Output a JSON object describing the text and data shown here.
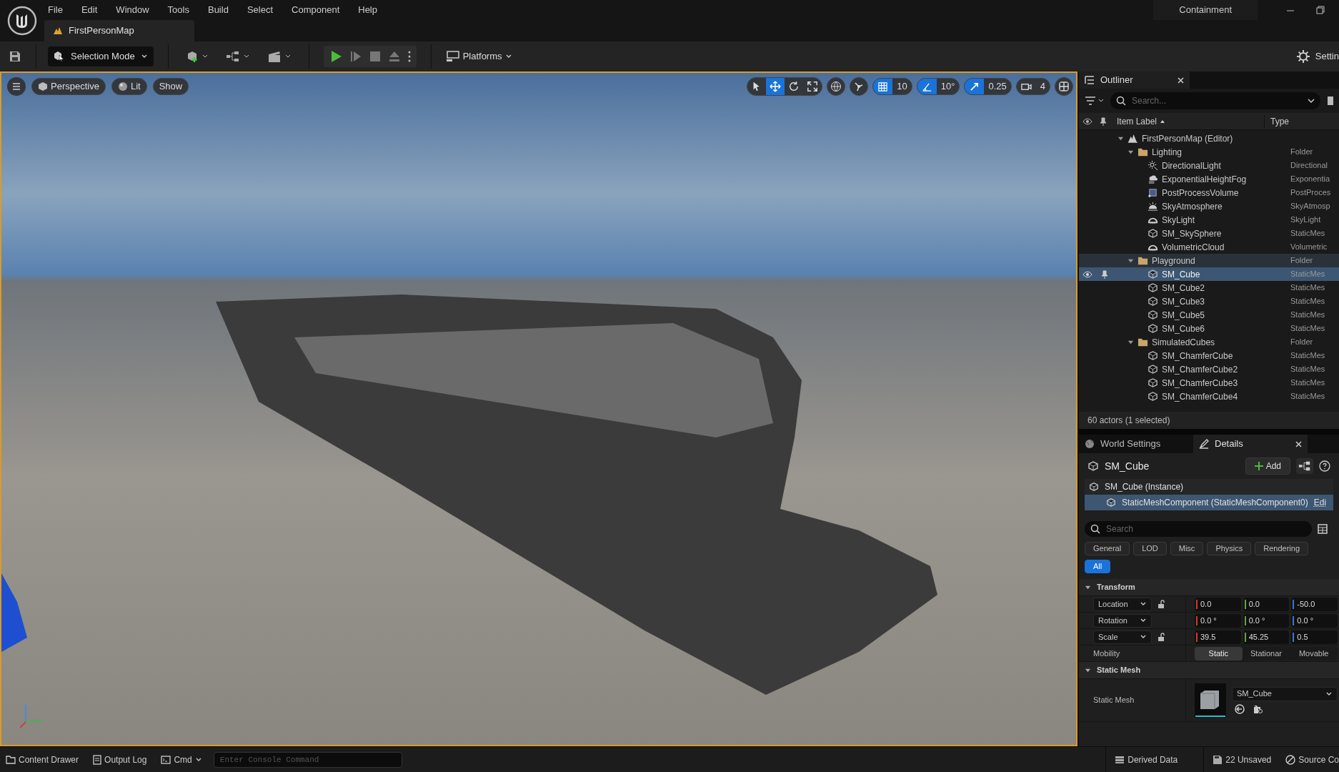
{
  "menu": [
    "File",
    "Edit",
    "Window",
    "Tools",
    "Build",
    "Select",
    "Component",
    "Help"
  ],
  "level_tab": {
    "label": "FirstPersonMap"
  },
  "layout_name": "Containment",
  "toolbar": {
    "mode": "Selection Mode",
    "platforms": "Platforms",
    "settings": "Settin"
  },
  "viewport": {
    "view_buttons": [
      "Perspective",
      "Lit",
      "Show"
    ],
    "transform_tools": [
      {
        "kind": "select",
        "selected": false
      },
      {
        "kind": "move",
        "selected": true
      },
      {
        "kind": "rotate",
        "selected": false
      },
      {
        "kind": "scale",
        "selected": false
      }
    ],
    "snaps": [
      {
        "kind": "grid",
        "on": true,
        "value": "10"
      },
      {
        "kind": "angle",
        "on": true,
        "value": "10°"
      },
      {
        "kind": "scale",
        "on": true,
        "value": "0.25"
      },
      {
        "kind": "camera",
        "on": false,
        "value": "4"
      }
    ]
  },
  "outliner": {
    "title": "Outliner",
    "search": {
      "placeholder": "Search..."
    },
    "columns": [
      "Item Label",
      "Type"
    ],
    "tree": [
      {
        "label": "FirstPersonMap (Editor)",
        "kind": "map",
        "selected": false,
        "highlighted": false,
        "expanded": true,
        "children": [
          {
            "label": "Lighting",
            "kind": "folder",
            "type": "Folder",
            "selected": false,
            "highlighted": false,
            "expanded": true,
            "children": [
              {
                "label": "DirectionalLight",
                "kind": "light",
                "type": "Directional",
                "selected": false,
                "highlighted": false
              },
              {
                "label": "ExponentialHeightFog",
                "kind": "fog",
                "type": "Exponentia",
                "selected": false,
                "highlighted": false
              },
              {
                "label": "PostProcessVolume",
                "kind": "volume",
                "type": "PostProces",
                "selected": false,
                "highlighted": false
              },
              {
                "label": "SkyAtmosphere",
                "kind": "sky",
                "type": "SkyAtmosp",
                "selected": false,
                "highlighted": false
              },
              {
                "label": "SkyLight",
                "kind": "cloud",
                "type": "SkyLight",
                "selected": false,
                "highlighted": false
              },
              {
                "label": "SM_SkySphere",
                "kind": "mesh",
                "type": "StaticMes",
                "selected": false,
                "highlighted": false
              },
              {
                "label": "VolumetricCloud",
                "kind": "cloud",
                "type": "Volumetric",
                "selected": false,
                "highlighted": false
              }
            ]
          },
          {
            "label": "Playground",
            "kind": "folder",
            "type": "Folder",
            "selected": false,
            "highlighted": true,
            "expanded": true,
            "children": [
              {
                "label": "SM_Cube",
                "kind": "mesh",
                "type": "StaticMes",
                "selected": true,
                "highlighted": false
              },
              {
                "label": "SM_Cube2",
                "kind": "mesh",
                "type": "StaticMes",
                "selected": false,
                "highlighted": false
              },
              {
                "label": "SM_Cube3",
                "kind": "mesh",
                "type": "StaticMes",
                "selected": false,
                "highlighted": false
              },
              {
                "label": "SM_Cube5",
                "kind": "mesh",
                "type": "StaticMes",
                "selected": false,
                "highlighted": false
              },
              {
                "label": "SM_Cube6",
                "kind": "mesh",
                "type": "StaticMes",
                "selected": false,
                "highlighted": false
              }
            ]
          },
          {
            "label": "SimulatedCubes",
            "kind": "folder",
            "type": "Folder",
            "selected": false,
            "highlighted": false,
            "expanded": true,
            "children": [
              {
                "label": "SM_ChamferCube",
                "kind": "mesh",
                "type": "StaticMes",
                "selected": false,
                "highlighted": false
              },
              {
                "label": "SM_ChamferCube2",
                "kind": "mesh",
                "type": "StaticMes",
                "selected": false,
                "highlighted": false
              },
              {
                "label": "SM_ChamferCube3",
                "kind": "mesh",
                "type": "StaticMes",
                "selected": false,
                "highlighted": false
              },
              {
                "label": "SM_ChamferCube4",
                "kind": "mesh",
                "type": "StaticMes",
                "selected": false,
                "highlighted": false
              }
            ]
          }
        ]
      }
    ],
    "status": "60 actors (1 selected)"
  },
  "details_tabs": [
    {
      "label": "World Settings",
      "selected": false
    },
    {
      "label": "Details",
      "selected": true
    }
  ],
  "details": {
    "actor": "SM_Cube",
    "add_button": "Add",
    "components": [
      {
        "label": "SM_Cube (Instance)",
        "selected": false,
        "children": [
          {
            "label": "StaticMeshComponent (StaticMeshComponent0)",
            "selected": true,
            "edit_link": "Edi"
          }
        ]
      }
    ],
    "search": {
      "placeholder": "Search"
    },
    "filters": [
      {
        "label": "General",
        "selected": false
      },
      {
        "label": "LOD",
        "selected": false
      },
      {
        "label": "Misc",
        "selected": false
      },
      {
        "label": "Physics",
        "selected": false
      },
      {
        "label": "Rendering",
        "selected": false
      },
      {
        "label": "All",
        "selected": true
      }
    ],
    "sections": [
      {
        "title": "Transform",
        "expanded": true,
        "rows": [
          {
            "kind": "vector",
            "name": "Location",
            "locked": false,
            "values": [
              "0.0",
              "0.0",
              "-50.0"
            ]
          },
          {
            "kind": "vector",
            "name": "Rotation",
            "values": [
              "0.0 °",
              "0.0 °",
              "0.0 °"
            ]
          },
          {
            "kind": "vector",
            "name": "Scale",
            "locked": false,
            "values": [
              "39.5",
              "45.25",
              "0.5"
            ]
          },
          {
            "kind": "choice",
            "name": "Mobility",
            "options": [
              {
                "label": "Static",
                "selected": true
              },
              {
                "label": "Stationar",
                "selected": false
              },
              {
                "label": "Movable",
                "selected": false
              }
            ]
          }
        ]
      },
      {
        "title": "Static Mesh",
        "expanded": true,
        "rows": [
          {
            "kind": "asset",
            "name": "Static Mesh",
            "value": "SM_Cube"
          }
        ]
      }
    ]
  },
  "bottom_bar": {
    "content_drawer": "Content Drawer",
    "output_log": "Output Log",
    "cmd": "Cmd",
    "console": {
      "placeholder": "Enter Console Command"
    },
    "derived_data": "Derived Data",
    "unsaved": "22 Unsaved",
    "source_control": "Source Co"
  }
}
